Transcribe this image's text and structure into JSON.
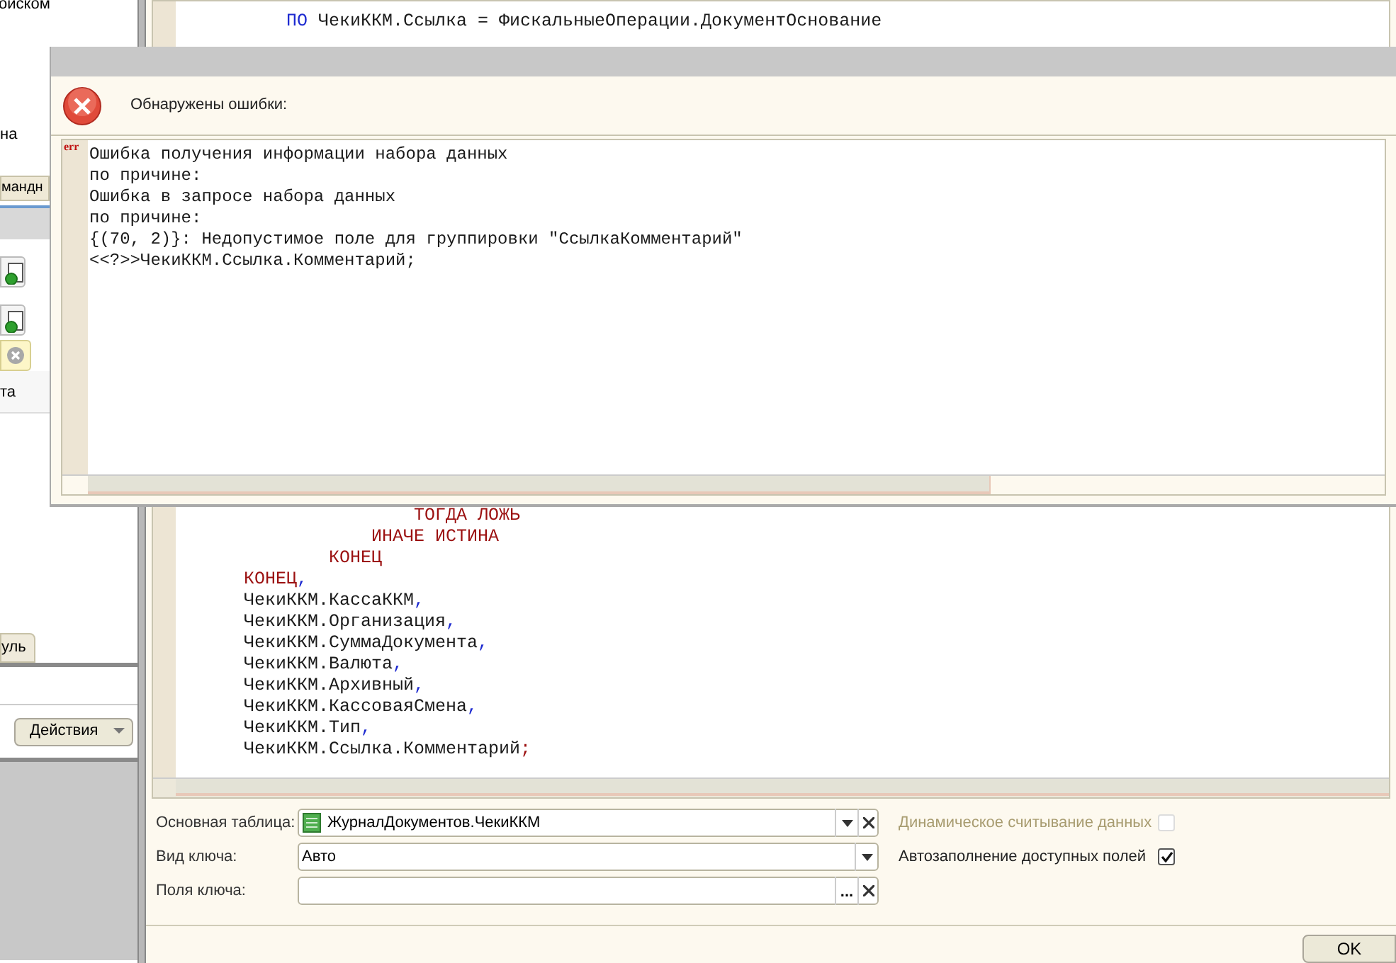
{
  "left_panel": {
    "texts": [
      {
        "kind": "text",
        "text": "оиском"
      },
      {
        "kind": "text",
        "text": "на"
      },
      {
        "kind": "tab",
        "text": "мандн"
      },
      {
        "kind": "bar"
      },
      {
        "kind": "icon_button"
      },
      {
        "kind": "icon_button"
      },
      {
        "kind": "clear_field"
      },
      {
        "kind": "text",
        "text": "та"
      }
    ],
    "bottom_tab": "уль",
    "actions_button": "Действия"
  },
  "editor": {
    "top_lines": [
      {
        "segments": [
          {
            "kind": "operator",
            "text": "          ПО"
          },
          {
            "kind": "plain",
            "text": " ЧекиККМ.Ссылка = ФискальныеОперации.ДокументОснование"
          }
        ]
      }
    ],
    "lines": [
      {
        "segments": [
          {
            "kind": "keyword",
            "text": "                      ТОГДА ЛОЖЬ"
          }
        ]
      },
      {
        "segments": [
          {
            "kind": "keyword",
            "text": "                  ИНАЧЕ ИСТИНА"
          }
        ]
      },
      {
        "segments": [
          {
            "kind": "keyword",
            "text": "              КОНЕЦ"
          }
        ]
      },
      {
        "segments": [
          {
            "kind": "keyword",
            "text": "      КОНЕЦ"
          },
          {
            "kind": "operator",
            "text": ","
          }
        ]
      },
      {
        "segments": [
          {
            "kind": "plain",
            "text": "      ЧекиККМ.КассаККМ"
          },
          {
            "kind": "operator",
            "text": ","
          }
        ]
      },
      {
        "segments": [
          {
            "kind": "plain",
            "text": "      ЧекиККМ.Организация"
          },
          {
            "kind": "operator",
            "text": ","
          }
        ]
      },
      {
        "segments": [
          {
            "kind": "plain",
            "text": "      ЧекиККМ.СуммаДокумента"
          },
          {
            "kind": "operator",
            "text": ","
          }
        ]
      },
      {
        "segments": [
          {
            "kind": "plain",
            "text": "      ЧекиККМ.Валюта"
          },
          {
            "kind": "operator",
            "text": ","
          }
        ]
      },
      {
        "segments": [
          {
            "kind": "plain",
            "text": "      ЧекиККМ.Архивный"
          },
          {
            "kind": "operator",
            "text": ","
          }
        ]
      },
      {
        "segments": [
          {
            "kind": "plain",
            "text": "      ЧекиККМ.КассоваяСмена"
          },
          {
            "kind": "operator",
            "text": ","
          }
        ]
      },
      {
        "segments": [
          {
            "kind": "plain",
            "text": "      ЧекиККМ.Тип"
          },
          {
            "kind": "operator",
            "text": ","
          }
        ]
      },
      {
        "segments": [
          {
            "kind": "plain",
            "text": "      ЧекиККМ.Ссылка.Комментарий"
          },
          {
            "kind": "keyword",
            "text": ";"
          }
        ]
      }
    ]
  },
  "form": {
    "fields": [
      {
        "label": "Основная таблица:",
        "value": "ЖурналДокументов.ЧекиККМ",
        "icon": true,
        "buttons": [
          {
            "kind": "dropdown"
          },
          {
            "kind": "clear"
          }
        ]
      },
      {
        "label": "Вид ключа:",
        "value": "Авто",
        "icon": false,
        "buttons": [
          {
            "kind": "dropdown"
          }
        ]
      },
      {
        "label": "Поля ключа:",
        "icon": false,
        "buttons": [
          {
            "kind": "select",
            "text": "..."
          },
          {
            "kind": "clear"
          }
        ]
      }
    ],
    "checkboxes": [
      {
        "label": "Динамическое считывание данных",
        "checked": false,
        "disabled": true
      },
      {
        "label": "Автозаполнение доступных полей",
        "checked": true,
        "disabled": false
      }
    ],
    "ok_button": "OK"
  },
  "error_dialog": {
    "header": "Обнаружены ошибки:",
    "marker": "err",
    "lines": [
      "Ошибка получения информации набора данных",
      "по причине:",
      "Ошибка в запросе набора данных",
      "по причине:",
      "{(70, 2)}: Недопустимое поле для группировки \"СсылкаКомментарий\"",
      "<<?>>ЧекиККМ.Ссылка.Комментарий;"
    ]
  }
}
